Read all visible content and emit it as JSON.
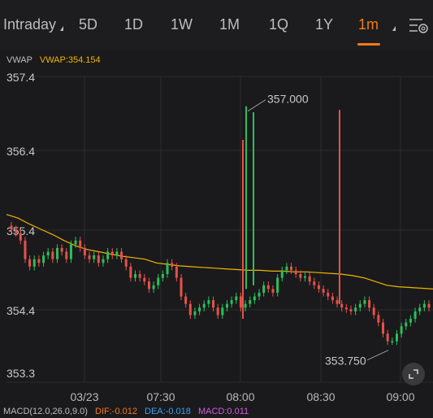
{
  "tabs": [
    {
      "label": "Intraday",
      "active": false,
      "has_caret": true
    },
    {
      "label": "5D",
      "active": false
    },
    {
      "label": "1D",
      "active": false
    },
    {
      "label": "1W",
      "active": false
    },
    {
      "label": "1M",
      "active": false
    },
    {
      "label": "1Q",
      "active": false
    },
    {
      "label": "1Y",
      "active": false
    },
    {
      "label": "1m",
      "active": true,
      "has_caret": true
    }
  ],
  "settings_icon": "settings-sliders-icon",
  "indicator": {
    "vwap_label": "VWAP",
    "vwap_value_text": "VWAP:354.154"
  },
  "macd": {
    "params": "MACD(12.0,26.0,9.0)",
    "dif": "DIF:-0.012",
    "dea": "DEA:-0.018",
    "macd": "MACD:0.011"
  },
  "colors": {
    "background": "#1a1a1c",
    "accent": "#f27a1d",
    "up": "#2bbf5a",
    "down": "#e5524a",
    "vwap": "#f0b400",
    "dif": "#f27a1d",
    "dea": "#3ba0f0",
    "macd": "#d05ce0"
  },
  "chart_data": {
    "type": "candlestick",
    "y_ticks": [
      "357.4",
      "356.4",
      "355.4",
      "354.4",
      "353.3"
    ],
    "x_ticks": [
      "03/23",
      "07:30",
      "08:00",
      "08:30",
      "09:00"
    ],
    "ylim": [
      353.3,
      357.4
    ],
    "annotations": [
      {
        "text": "357.000",
        "price": 357.0,
        "kind": "high"
      },
      {
        "text": "353.750",
        "price": 353.75,
        "kind": "low"
      }
    ],
    "vwap_series": [
      355.55,
      355.5,
      355.42,
      355.35,
      355.28,
      355.2,
      355.13,
      355.08,
      355.05,
      355.02,
      354.99,
      354.97,
      354.95,
      354.9,
      354.88,
      354.86,
      354.85,
      354.84,
      354.83,
      354.82,
      354.81,
      354.8,
      354.8,
      354.79,
      354.79,
      354.78,
      354.78,
      354.77,
      354.76,
      354.75,
      354.73,
      354.7,
      354.65,
      354.6,
      354.58,
      354.57,
      354.56,
      354.55
    ],
    "closes": [
      355.35,
      355.3,
      355.2,
      354.95,
      354.85,
      354.95,
      354.9,
      355.0,
      355.05,
      354.95,
      355.1,
      355.05,
      354.95,
      355.15,
      355.2,
      355.1,
      355.0,
      354.95,
      355.0,
      354.9,
      354.95,
      355.05,
      355.0,
      355.05,
      354.95,
      354.85,
      354.7,
      354.75,
      354.7,
      354.65,
      354.55,
      354.6,
      354.7,
      354.75,
      354.9,
      354.85,
      354.7,
      354.45,
      354.35,
      354.2,
      354.25,
      354.3,
      354.35,
      354.4,
      354.3,
      354.2,
      354.3,
      354.35,
      354.4,
      354.45,
      354.3,
      354.35,
      354.4,
      354.45,
      354.5,
      354.6,
      354.55,
      354.5,
      354.7,
      354.8,
      354.85,
      354.8,
      354.75,
      354.7,
      354.72,
      354.65,
      354.6,
      354.55,
      354.5,
      354.45,
      354.4,
      354.35,
      354.3,
      354.28,
      354.25,
      354.3,
      354.35,
      354.4,
      354.3,
      354.2,
      354.1,
      353.95,
      353.85,
      353.85,
      353.95,
      354.05,
      354.1,
      354.15,
      354.25,
      354.3,
      354.35,
      354.3
    ]
  }
}
